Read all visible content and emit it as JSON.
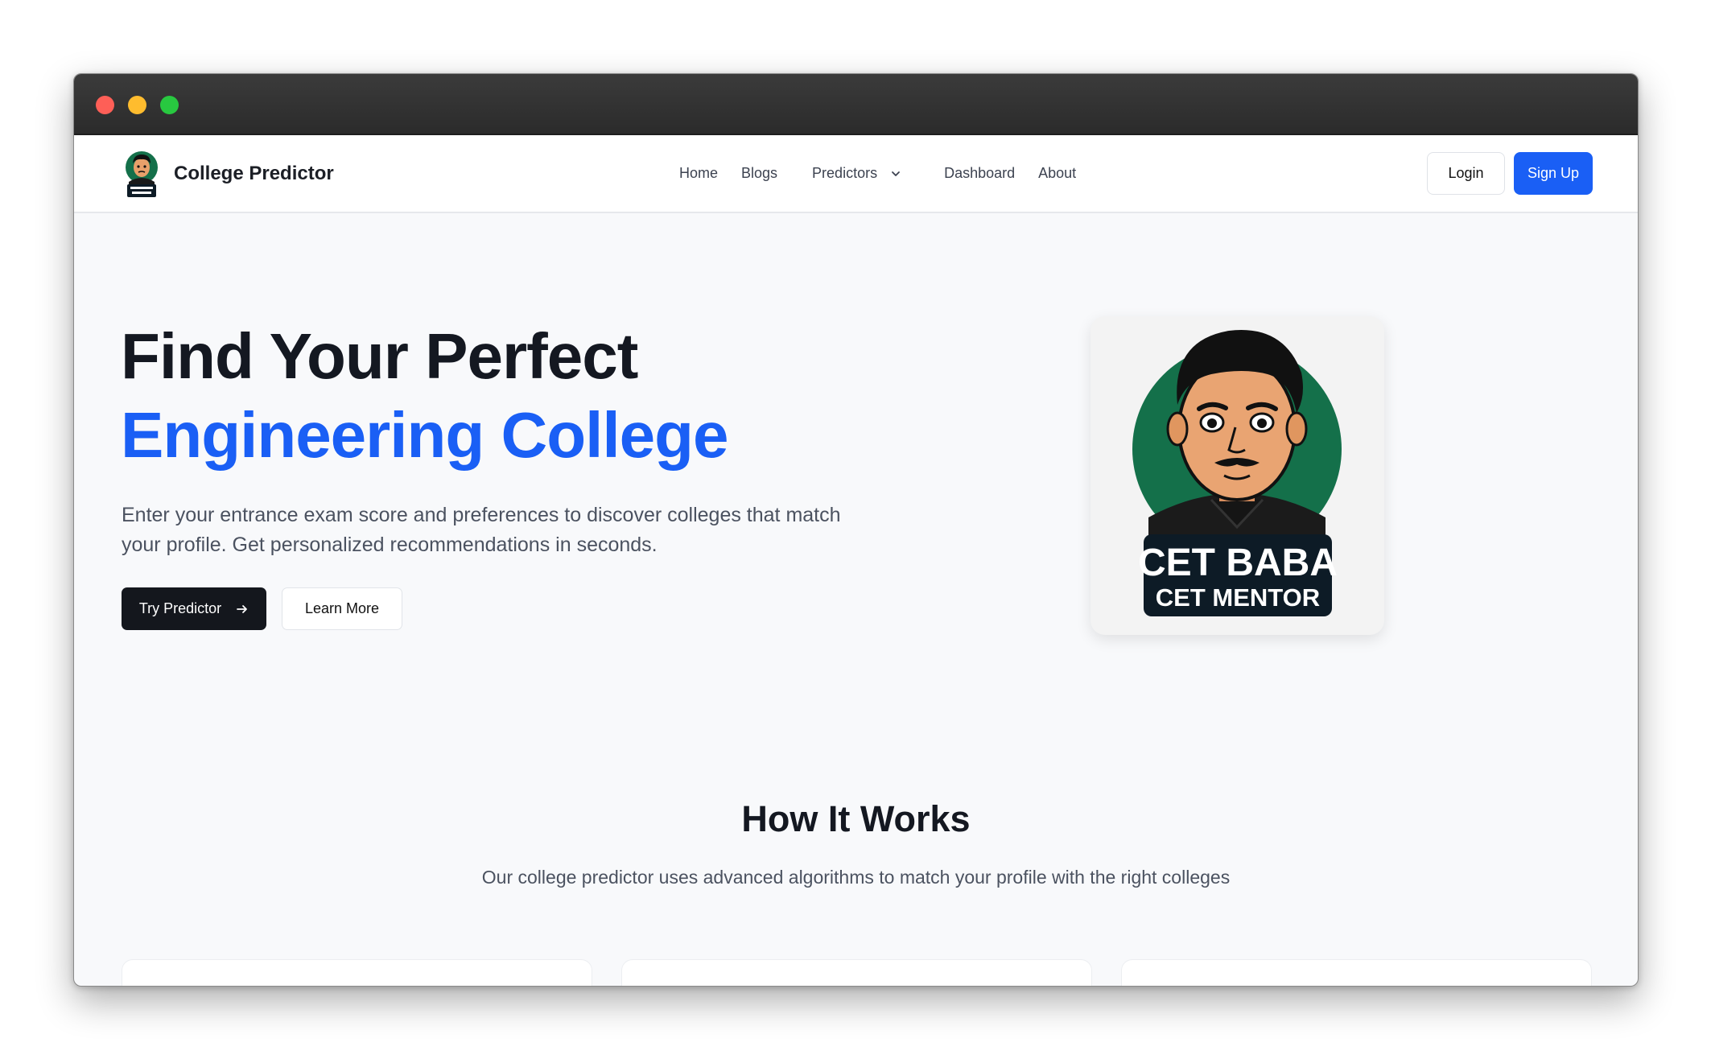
{
  "navbar": {
    "brand": "College Predictor",
    "links": [
      "Home",
      "Blogs",
      "Predictors",
      "Dashboard",
      "About"
    ],
    "login": "Login",
    "signup": "Sign Up"
  },
  "hero": {
    "title_line1": "Find Your Perfect",
    "title_line2": "Engineering College",
    "description": "Enter your entrance exam score and preferences to discover colleges that match your profile. Get personalized recommendations in seconds.",
    "primary_button": "Try Predictor",
    "secondary_button": "Learn More",
    "logo_text_main": "CET BABA",
    "logo_text_sub": "CET MENTOR"
  },
  "how_it_works": {
    "title": "How It Works",
    "subtitle": "Our college predictor uses advanced algorithms to match your profile with the right colleges"
  },
  "colors": {
    "accent": "#1a5ff5",
    "dark_button": "#14171d",
    "logo_green": "#14704a"
  },
  "icons": [
    "chevron-down-icon",
    "arrow-right-icon"
  ]
}
